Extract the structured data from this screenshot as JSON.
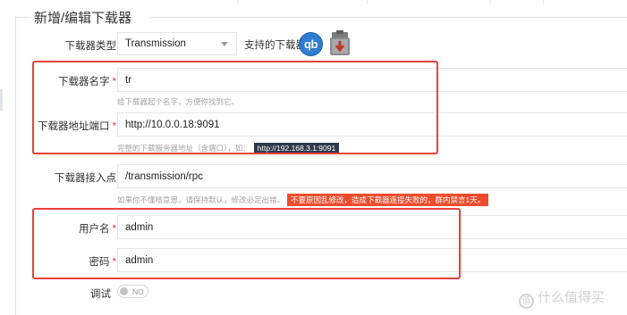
{
  "form": {
    "legend": "新增/编辑下载器",
    "client_type": {
      "label": "下载器类型",
      "value": "Transmission",
      "supported_label": "支持的下载器：",
      "supported_icons": [
        "qbittorrent-icon",
        "transmission-icon"
      ],
      "qb_text": "qb"
    },
    "name": {
      "label": "下载器名字",
      "required": "*",
      "value": "tr",
      "help": "给下载器起个名字，方便你找到它。"
    },
    "address": {
      "label": "下载器地址端口",
      "required": "*",
      "value": "http://10.0.0.18:9091",
      "help": "完整的下载服务器地址（含端口），如：",
      "example": "http://192.168.3.1:9091"
    },
    "endpoint": {
      "label": "下载器接入点",
      "value": "/transmission/rpc",
      "help": "如果你不懂啥意思，请保持默认，修改必定出错。",
      "warning": "不要原因乱修改，造成下载器连接失败的，群内禁言1天。"
    },
    "username": {
      "label": "用户名",
      "required": "*",
      "value": "admin"
    },
    "password": {
      "label": "密码",
      "required": "*",
      "value": "admin"
    },
    "debug": {
      "label": "调试",
      "state": "NO",
      "on": false
    }
  },
  "watermark": {
    "text": "什么值得买",
    "icon_text": "值"
  },
  "colors": {
    "required": "#e0332b",
    "highlight_box": "#e8413a",
    "example_tag": "#2e3a4a",
    "warning_tag": "#ee4d2d",
    "qb_blue": "#2f7dd1"
  }
}
